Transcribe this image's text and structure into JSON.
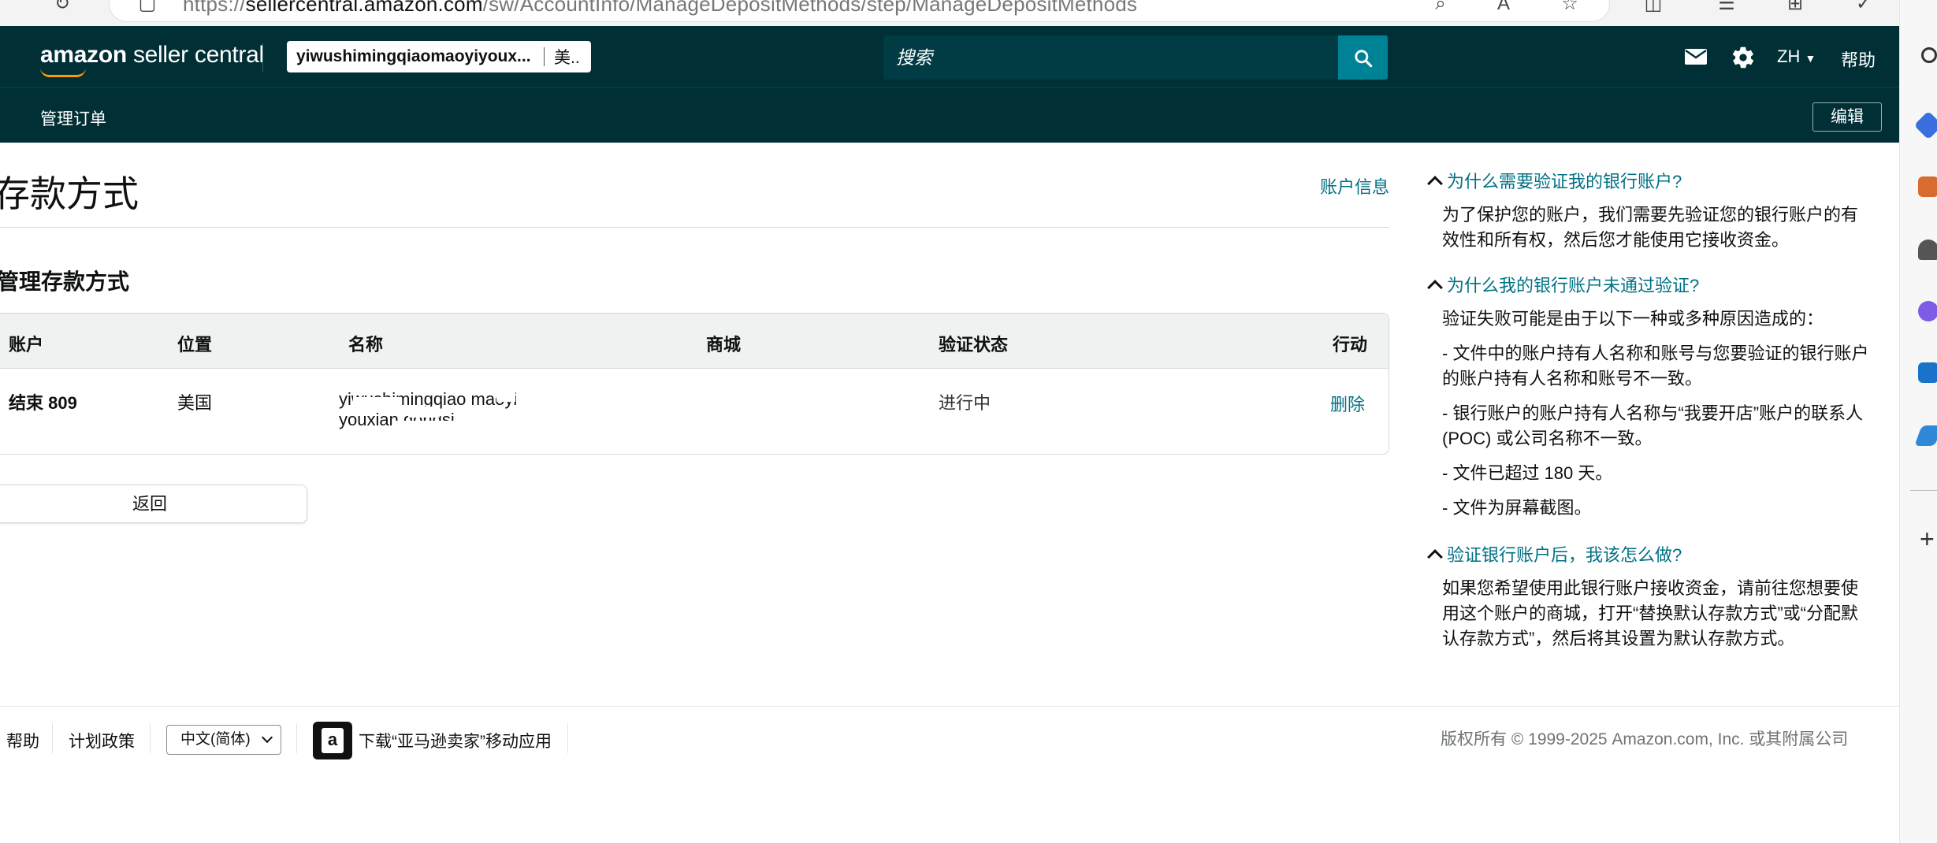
{
  "browser": {
    "url_prefix": "https://",
    "url_host": "sellercentral.amazon.com",
    "url_path": "/sw/AccountInfo/ManageDepositMethods/step/ManageDepositMethods"
  },
  "header": {
    "logo_brand": "amazon",
    "logo_product": "seller central",
    "account_name": "yiwushimingqiaomaoyiyoux...",
    "account_marketplace": "美..",
    "search_placeholder": "搜索",
    "language": "ZH",
    "help_label": "帮助",
    "sub_nav_item": "管理订单",
    "edit_label": "编辑"
  },
  "main": {
    "page_title": "存款方式",
    "account_info_link": "账户信息",
    "section_title": "管理存款方式",
    "table": {
      "headers": [
        "账户",
        "位置",
        "名称",
        "商城",
        "验证状态",
        "行动"
      ],
      "rows": [
        {
          "account": "结束 809",
          "location": "美国",
          "name": "yiwushimingqiao maoyi youxian gongsi",
          "marketplace": "",
          "status": "进行中",
          "action": "删除"
        }
      ]
    },
    "back_button": "返回"
  },
  "help": {
    "faqs": [
      {
        "question": "为什么需要验证我的银行账户?",
        "answer": [
          "为了保护您的账户，我们需要先验证您的银行账户的有效性和所有权，然后您才能使用它接收资金。"
        ]
      },
      {
        "question": "为什么我的银行账户未通过验证?",
        "answer": [
          "验证失败可能是由于以下一种或多种原因造成的：",
          "- 文件中的账户持有人名称和账号与您要验证的银行账户的账户持有人名称和账号不一致。",
          "- 银行账户的账户持有人名称与“我要开店”账户的联系人 (POC) 或公司名称不一致。",
          "- 文件已超过 180 天。",
          "- 文件为屏幕截图。"
        ]
      },
      {
        "question": "验证银行账户后，我该怎么做?",
        "answer": [
          "如果您希望使用此银行账户接收资金，请前往您想要使用这个账户的商城，打开“替换默认存款方式”或“分配默认存款方式”，然后将其设置为默认存款方式。"
        ]
      }
    ]
  },
  "footer": {
    "help": "帮助",
    "policy": "计划政策",
    "language_select": "中文(简体)",
    "app_download": "下载“亚马逊卖家”移动应用",
    "copyright": "版权所有 © 1999-2025 Amazon.com, Inc. 或其附属公司"
  },
  "colors": {
    "header_bg": "#002f36",
    "search_button": "#008296",
    "link": "#007185",
    "logo_smile": "#ff9900"
  }
}
